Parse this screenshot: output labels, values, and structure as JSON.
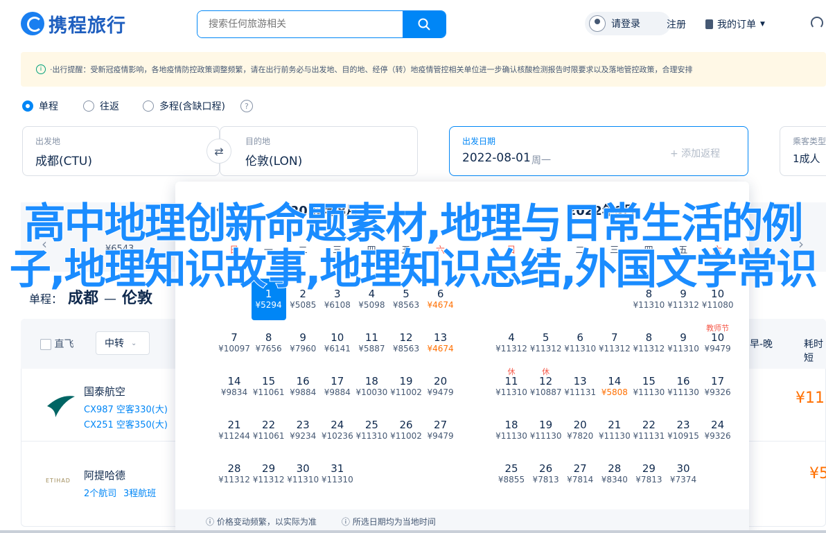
{
  "header": {
    "brand": "携程旅行",
    "search_placeholder": "搜索任何旅游相关",
    "login": "请登录",
    "register": "注册",
    "orders": "我的订单"
  },
  "notice": {
    "text": "·出行提醒：受新冠疫情影响，各地疫情防控政策调整频繁，请在出行前务必与出发地、目的地、经停（转）地疫情管控相关单位进一步确认核酸检测报告时限要求以及落地管控政策，合理安排"
  },
  "trip_type": {
    "options": [
      "单程",
      "往返",
      "多程(含缺口程)"
    ],
    "selected": "单程"
  },
  "search_form": {
    "from_label": "出发地",
    "from_value": "成都(CTU)",
    "to_label": "目的地",
    "to_value": "伦敦(LON)",
    "date_label": "出发日期",
    "date_value": "2022-08-01",
    "date_weekday": "周一",
    "add_return": "+ 添加返程",
    "pax_label": "乘客类型",
    "pax_value": "1成人"
  },
  "calendar": {
    "months": [
      {
        "title": "2022年8月",
        "weekdays": [
          "日",
          "一",
          "二",
          "三",
          "四",
          "五",
          "六"
        ],
        "days": [
          {
            "d": "1",
            "p": "¥5294",
            "col": 1,
            "row": 0,
            "sel": true
          },
          {
            "d": "2",
            "p": "¥5085",
            "col": 2,
            "row": 0
          },
          {
            "d": "3",
            "p": "¥6108",
            "col": 3,
            "row": 0
          },
          {
            "d": "4",
            "p": "¥5098",
            "col": 4,
            "row": 0
          },
          {
            "d": "5",
            "p": "¥8563",
            "col": 5,
            "row": 0
          },
          {
            "d": "6",
            "p": "¥4674",
            "col": 6,
            "row": 0,
            "low": true
          },
          {
            "d": "7",
            "p": "¥10097",
            "col": 0,
            "row": 1
          },
          {
            "d": "8",
            "p": "¥7656",
            "col": 1,
            "row": 1
          },
          {
            "d": "9",
            "p": "¥7960",
            "col": 2,
            "row": 1
          },
          {
            "d": "10",
            "p": "¥6141",
            "col": 3,
            "row": 1
          },
          {
            "d": "11",
            "p": "¥5887",
            "col": 4,
            "row": 1
          },
          {
            "d": "12",
            "p": "¥8563",
            "col": 5,
            "row": 1
          },
          {
            "d": "13",
            "p": "¥4674",
            "col": 6,
            "row": 1,
            "low": true
          },
          {
            "d": "14",
            "p": "¥9834",
            "col": 0,
            "row": 2
          },
          {
            "d": "15",
            "p": "¥11061",
            "col": 1,
            "row": 2
          },
          {
            "d": "16",
            "p": "¥9884",
            "col": 2,
            "row": 2
          },
          {
            "d": "17",
            "p": "¥9884",
            "col": 3,
            "row": 2
          },
          {
            "d": "18",
            "p": "¥10030",
            "col": 4,
            "row": 2
          },
          {
            "d": "19",
            "p": "¥11002",
            "col": 5,
            "row": 2
          },
          {
            "d": "20",
            "p": "¥9479",
            "col": 6,
            "row": 2
          },
          {
            "d": "21",
            "p": "¥11244",
            "col": 0,
            "row": 3
          },
          {
            "d": "22",
            "p": "¥11061",
            "col": 1,
            "row": 3
          },
          {
            "d": "23",
            "p": "¥9234",
            "col": 2,
            "row": 3
          },
          {
            "d": "24",
            "p": "¥10236",
            "col": 3,
            "row": 3
          },
          {
            "d": "25",
            "p": "¥11310",
            "col": 4,
            "row": 3
          },
          {
            "d": "26",
            "p": "¥11002",
            "col": 5,
            "row": 3
          },
          {
            "d": "27",
            "p": "¥9479",
            "col": 6,
            "row": 3
          },
          {
            "d": "28",
            "p": "¥11312",
            "col": 0,
            "row": 4
          },
          {
            "d": "29",
            "p": "¥11312",
            "col": 1,
            "row": 4
          },
          {
            "d": "30",
            "p": "¥11310",
            "col": 2,
            "row": 4
          },
          {
            "d": "31",
            "p": "¥11310",
            "col": 3,
            "row": 4
          }
        ]
      },
      {
        "title": "2022年9月",
        "weekdays": [
          "日",
          "一",
          "二",
          "三",
          "四",
          "五",
          "六"
        ],
        "days": [
          {
            "d": "8",
            "p": "¥11310",
            "col": 4,
            "row": 0
          },
          {
            "d": "9",
            "p": "¥11312",
            "col": 5,
            "row": 0
          },
          {
            "d": "10",
            "p": "¥11080",
            "col": 6,
            "row": 0
          },
          {
            "d": "4",
            "p": "¥11312",
            "col": 0,
            "row": 1
          },
          {
            "d": "5",
            "p": "¥11312",
            "col": 1,
            "row": 1
          },
          {
            "d": "6",
            "p": "¥11310",
            "col": 2,
            "row": 1
          },
          {
            "d": "7",
            "p": "¥11312",
            "col": 3,
            "row": 1
          },
          {
            "d": "8",
            "p": "¥11312",
            "col": 4,
            "row": 1
          },
          {
            "d": "9",
            "p": "¥11310",
            "col": 5,
            "row": 1
          },
          {
            "d": "10",
            "p": "¥9479",
            "col": 6,
            "row": 1,
            "tag": "教师节"
          },
          {
            "d": "11",
            "p": "¥11310",
            "col": 0,
            "row": 2,
            "tag": "休"
          },
          {
            "d": "12",
            "p": "¥10887",
            "col": 1,
            "row": 2,
            "tag": "休"
          },
          {
            "d": "13",
            "p": "¥11131",
            "col": 2,
            "row": 2
          },
          {
            "d": "14",
            "p": "¥5808",
            "col": 3,
            "row": 2,
            "low": true
          },
          {
            "d": "15",
            "p": "¥11130",
            "col": 4,
            "row": 2
          },
          {
            "d": "16",
            "p": "¥11130",
            "col": 5,
            "row": 2
          },
          {
            "d": "17",
            "p": "¥9326",
            "col": 6,
            "row": 2
          },
          {
            "d": "18",
            "p": "¥11130",
            "col": 0,
            "row": 3
          },
          {
            "d": "19",
            "p": "¥11130",
            "col": 1,
            "row": 3
          },
          {
            "d": "20",
            "p": "¥7820",
            "col": 2,
            "row": 3
          },
          {
            "d": "21",
            "p": "¥11130",
            "col": 3,
            "row": 3
          },
          {
            "d": "22",
            "p": "¥11131",
            "col": 4,
            "row": 3
          },
          {
            "d": "23",
            "p": "¥10915",
            "col": 5,
            "row": 3
          },
          {
            "d": "24",
            "p": "¥9326",
            "col": 6,
            "row": 3
          },
          {
            "d": "25",
            "p": "¥8855",
            "col": 0,
            "row": 4
          },
          {
            "d": "26",
            "p": "¥7813",
            "col": 1,
            "row": 4
          },
          {
            "d": "27",
            "p": "¥7814",
            "col": 2,
            "row": 4
          },
          {
            "d": "28",
            "p": "¥8340",
            "col": 3,
            "row": 4
          },
          {
            "d": "29",
            "p": "¥7813",
            "col": 4,
            "row": 4
          },
          {
            "d": "30",
            "p": "¥7374",
            "col": 5,
            "row": 4
          }
        ]
      }
    ],
    "footer_notes": [
      "价格变动频繁，以实际为准",
      "所选日期均为当地时间"
    ]
  },
  "background_prices": [
    "¥6543"
  ],
  "route": {
    "label": "单程：",
    "from": "成都",
    "to": "伦敦"
  },
  "filters": {
    "direct": "直飞",
    "transfer": "中转",
    "sort_time": "早-晚",
    "duration": "耗时短"
  },
  "results": [
    {
      "airline": "国泰航空",
      "line1": "CX987 空客330(大)",
      "line2": "CX251 空客350(大)",
      "price": "¥11"
    },
    {
      "airline": "阿提哈德",
      "line1": "2个航司",
      "line2": "3程航班",
      "price": "¥5"
    }
  ],
  "overlay_text": "高中地理创新命题素材,地理与日常生活的例子,地理知识故事,地理知识总结,外国文学常识",
  "colors": {
    "accent": "#0086f6",
    "price": "#ff6f00",
    "holiday": "#f5594a"
  }
}
